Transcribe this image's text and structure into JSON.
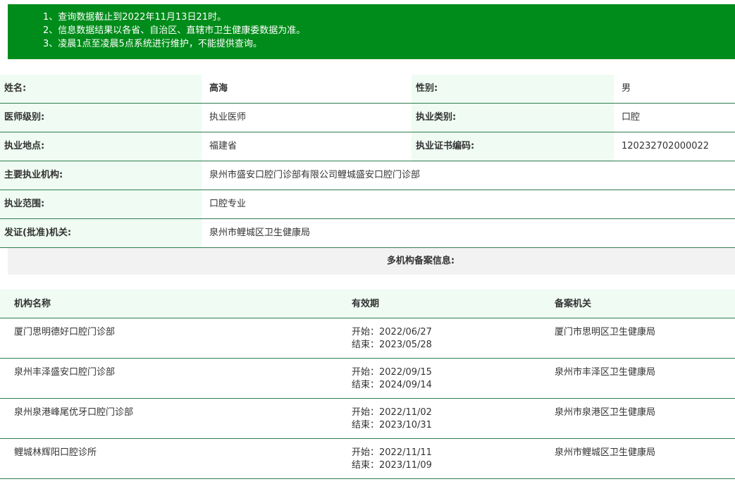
{
  "notice": [
    "1、查询数据截止到2022年11月13日21时。",
    "2、信息数据结果以各省、自治区、直辖市卫生健康委数据为准。",
    "3、凌晨1点至凌晨5点系统进行维护，不能提供查询。"
  ],
  "info": {
    "name_label": "姓名:",
    "name_value": "高海",
    "gender_label": "性别:",
    "gender_value": "男",
    "level_label": "医师级别:",
    "level_value": "执业医师",
    "category_label": "执业类别:",
    "category_value": "口腔",
    "location_label": "执业地点:",
    "location_value": "福建省",
    "cert_label": "执业证书编码:",
    "cert_value": "120232702000022",
    "org_label": "主要执业机构:",
    "org_value": "泉州市盛安口腔门诊部有限公司鲤城盛安口腔门诊部",
    "scope_label": "执业范围:",
    "scope_value": "口腔专业",
    "issuer_label": "发证(批准)机关:",
    "issuer_value": "泉州市鲤城区卫生健康局"
  },
  "multi": {
    "title": "多机构备案信息:",
    "headers": [
      "机构名称",
      "有效期",
      "备案机关"
    ],
    "rows": [
      {
        "org": "厦门思明德好口腔门诊部",
        "start": "开始：2022/06/27",
        "end": "结束：2023/05/28",
        "authority": "厦门市思明区卫生健康局"
      },
      {
        "org": "泉州丰泽盛安口腔门诊部",
        "start": "开始：2022/09/15",
        "end": "结束：2024/09/14",
        "authority": "泉州市丰泽区卫生健康局"
      },
      {
        "org": "泉州泉港峰尾优牙口腔门诊部",
        "start": "开始：2022/11/02",
        "end": "结束：2023/10/31",
        "authority": "泉州市泉港区卫生健康局"
      },
      {
        "org": "鲤城林辉阳口腔诊所",
        "start": "开始：2022/11/11",
        "end": "结束：2023/11/09",
        "authority": "泉州市鲤城区卫生健康局"
      }
    ]
  }
}
